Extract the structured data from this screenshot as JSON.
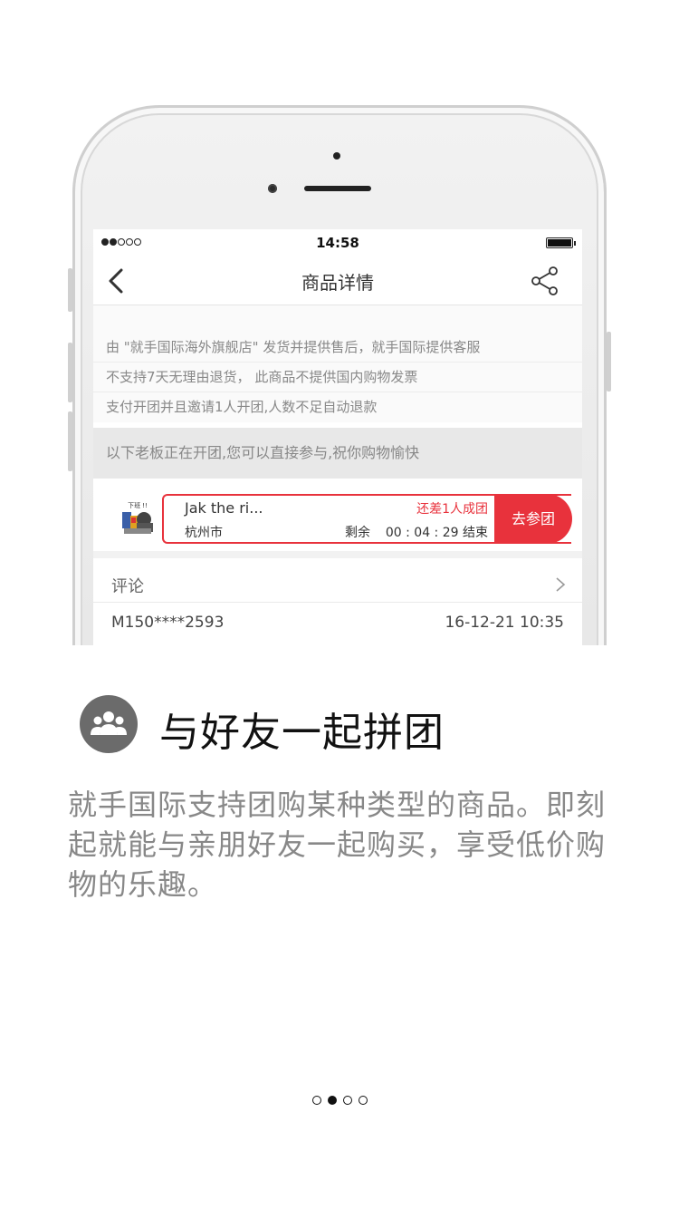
{
  "status_bar": {
    "time": "14:58"
  },
  "nav": {
    "title": "商品详情"
  },
  "notes": [
    "由 \"就手国际海外旗舰店\" 发货并提供售后，就手国际提供客服",
    "不支持7天无理由退货， 此商品不提供国内购物发票",
    "支付开团并且邀请1人开团,人数不足自动退款"
  ],
  "tip": "以下老板正在开团,您可以直接参与,祝你购物愉快",
  "group": {
    "name": "Jak the ri...",
    "need": "还差1人成团",
    "city": "杭州市",
    "remaining_label": "剩余",
    "timer": "00 : 04 : 29 结束",
    "join_label": "去参团",
    "avatar_caption": "下班 !!"
  },
  "comments": {
    "label": "评论",
    "items": [
      {
        "user": "M150****2593",
        "date": "16-12-21 10:35"
      }
    ]
  },
  "feature": {
    "icon": "group-people-icon",
    "title": "与好友一起拼团",
    "description": "就手国际支持团购某种类型的商品。即刻起就能与亲朋好友一起购买，享受低价购物的乐趣。"
  },
  "pager": {
    "count": 4,
    "active_index": 1
  },
  "colors": {
    "accent": "#e8323c",
    "icon_bg": "#6b6b6b"
  }
}
